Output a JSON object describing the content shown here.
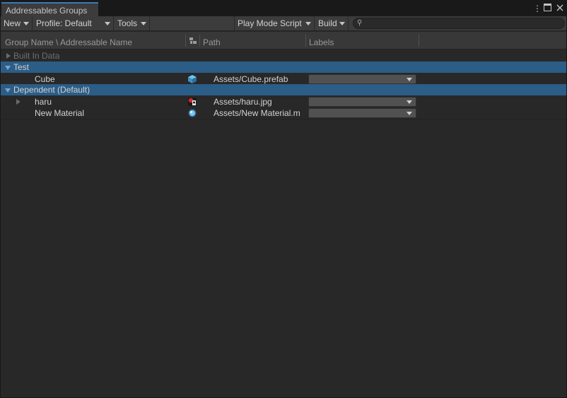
{
  "window": {
    "tab_title": "Addressables Groups",
    "controls": [
      "more-icon",
      "maximize-icon",
      "close-icon"
    ]
  },
  "toolbar": {
    "new_label": "New",
    "profile_label": "Profile: Default",
    "tools_label": "Tools",
    "play_mode_label": "Play Mode Script",
    "build_label": "Build",
    "search_placeholder": ""
  },
  "columns": {
    "name": "Group Name \\ Addressable Name",
    "type_icon": "asset-type-icon",
    "path": "Path",
    "labels": "Labels"
  },
  "tree": {
    "built_in": {
      "label": "Built In Data"
    },
    "groups": [
      {
        "label": "Test",
        "entries": [
          {
            "name": "Cube",
            "icon": "prefab-cube-icon",
            "path": "Assets/Cube.prefab",
            "labels_value": ""
          }
        ]
      },
      {
        "label": "Dependent (Default)",
        "entries": [
          {
            "name": "haru",
            "icon": "texture-image-icon",
            "path": "Assets/haru.jpg",
            "labels_value": ""
          },
          {
            "name": "New Material",
            "icon": "material-sphere-icon",
            "path": "Assets/New Material.m",
            "labels_value": ""
          }
        ]
      }
    ]
  },
  "colors": {
    "selected_row": "#2c5d87",
    "tab_accent": "#3a79bb",
    "background": "#282828"
  }
}
